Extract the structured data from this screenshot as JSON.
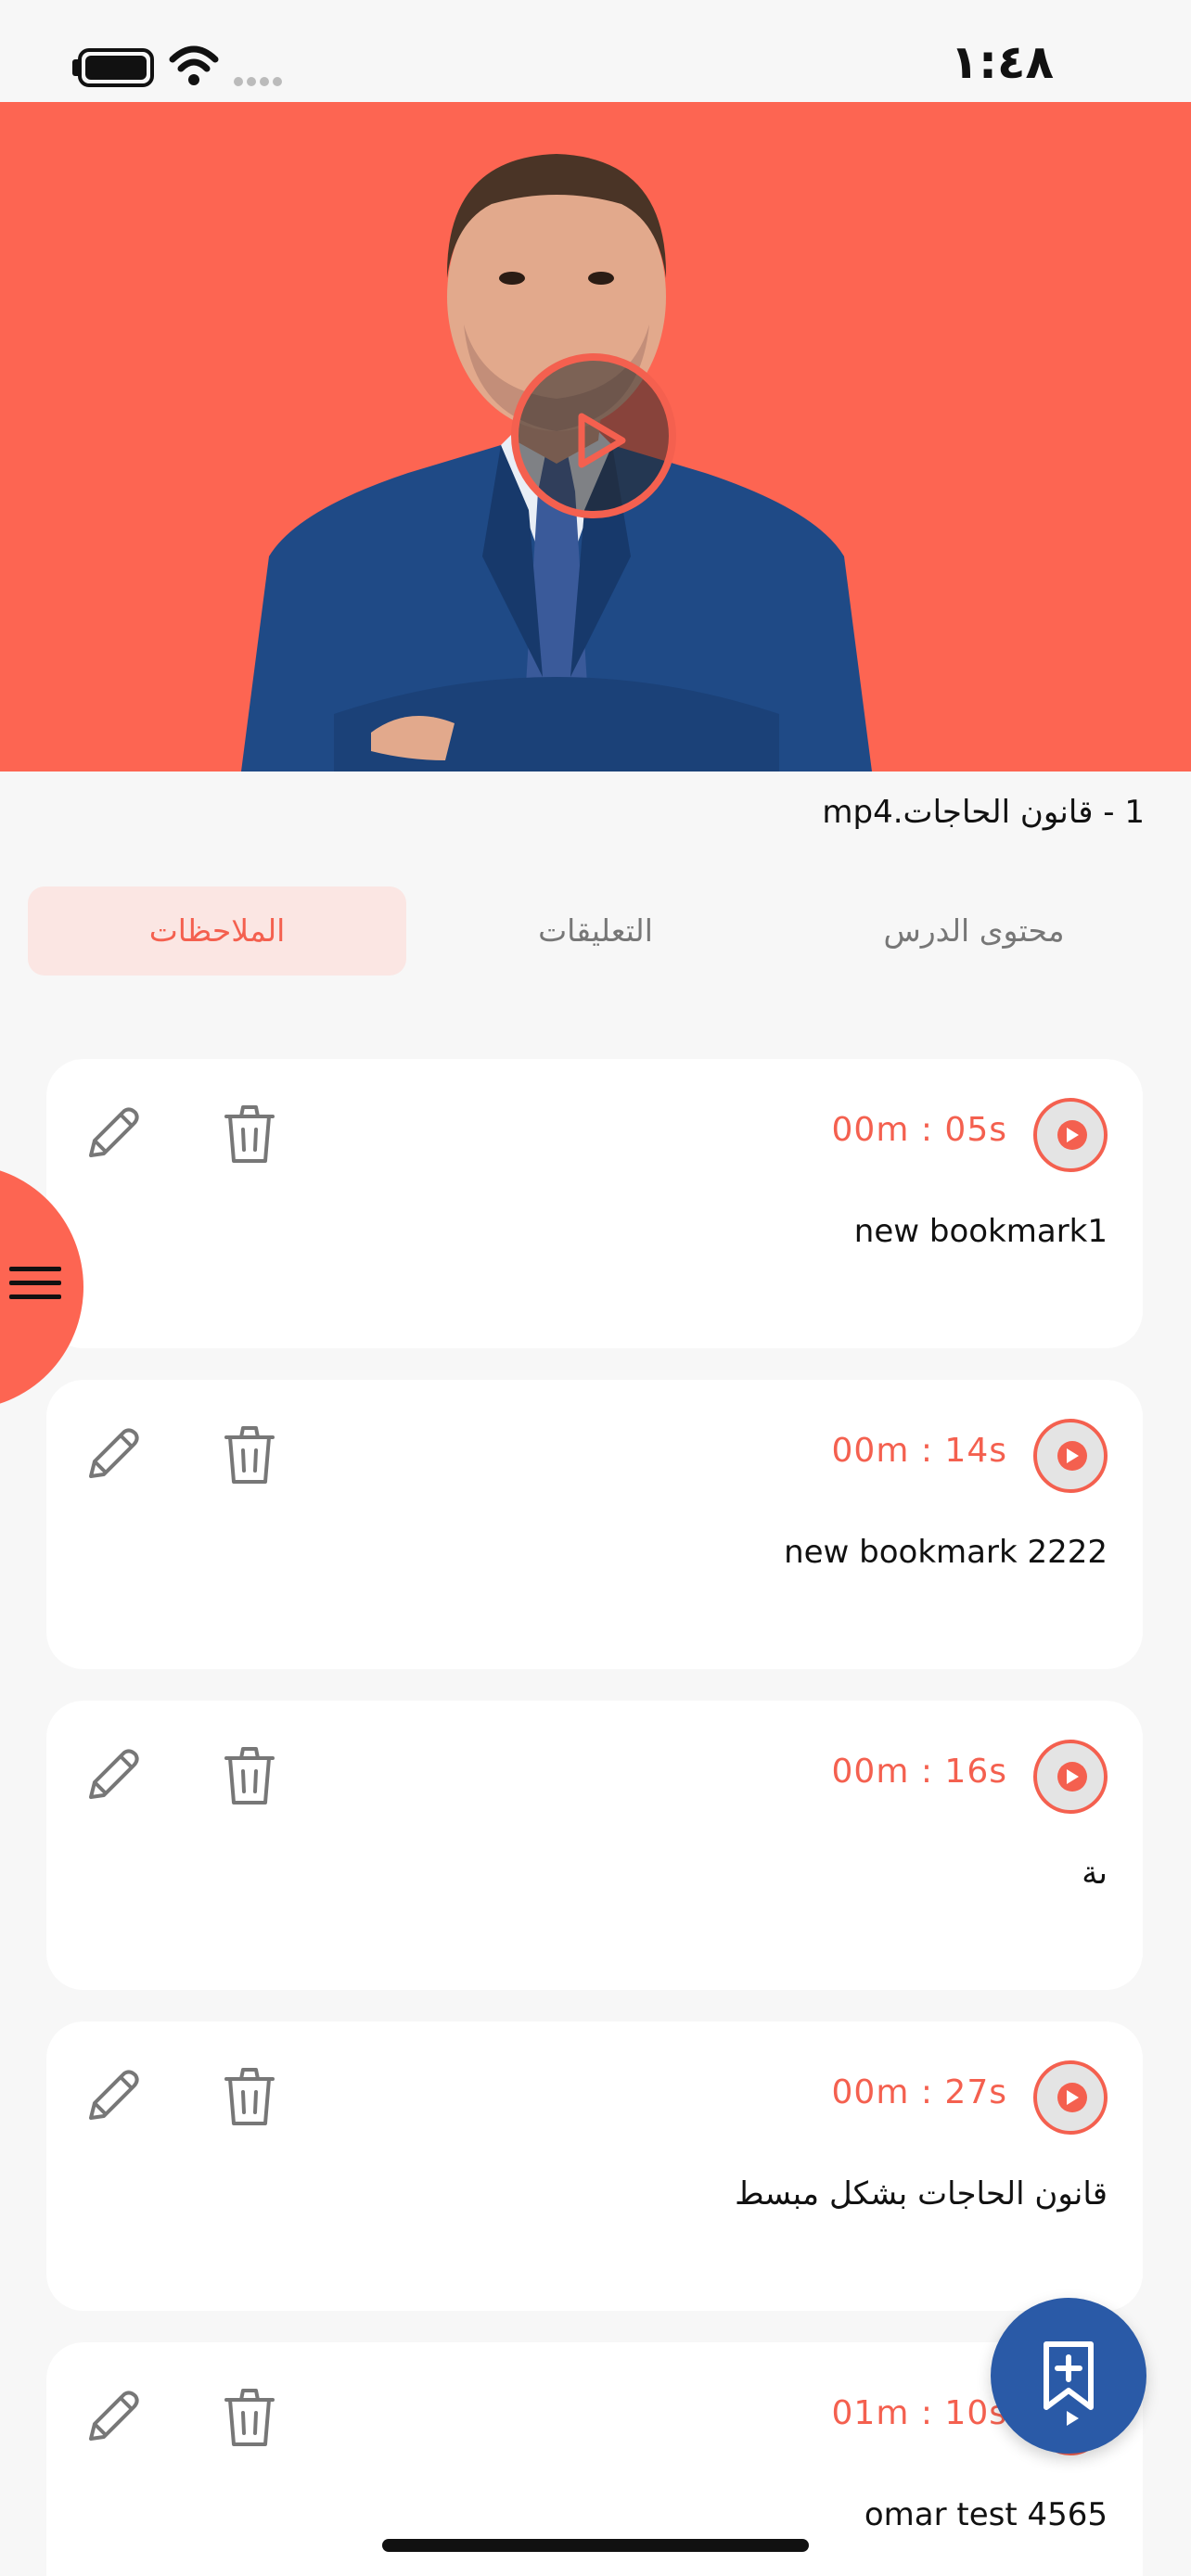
{
  "status_bar": {
    "time": "١:٤٨",
    "icons": [
      "battery-icon",
      "wifi-icon",
      "cellular-signal-icon"
    ]
  },
  "video": {
    "background_color": "#fd6552",
    "play_button_icon": "play-icon"
  },
  "lesson": {
    "title": "1 - قانون الحاجات.mp4"
  },
  "tabs": [
    {
      "label": "محتوى الدرس",
      "active": false
    },
    {
      "label": "التعليقات",
      "active": false
    },
    {
      "label": "الملاحظات",
      "active": true
    }
  ],
  "notes": [
    {
      "timestamp": "00m : 05s",
      "text": "new bookmark1"
    },
    {
      "timestamp": "00m : 14s",
      "text": "new bookmark 2222"
    },
    {
      "timestamp": "00m : 16s",
      "text": "ىة"
    },
    {
      "timestamp": "00m : 27s",
      "text": "قانون الحاجات بشكل مبسط"
    },
    {
      "timestamp": "01m : 10s",
      "text": "omar test 4565"
    }
  ],
  "actions": {
    "edit_icon": "pencil-icon",
    "delete_icon": "trash-icon",
    "add_bookmark_icon": "bookmark-add-icon",
    "menu_icon": "hamburger-menu-icon"
  },
  "colors": {
    "accent": "#f4604f",
    "fab": "#2a5aa7",
    "active_tab_bg": "#fbe6e3"
  }
}
